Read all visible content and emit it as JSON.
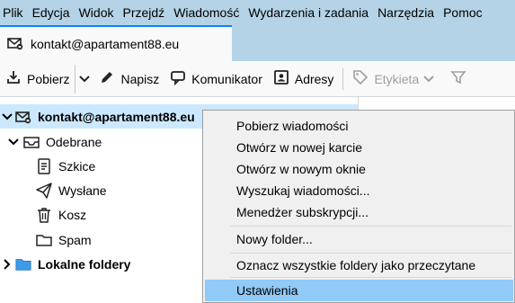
{
  "menubar": {
    "items": [
      "Plik",
      "Edycja",
      "Widok",
      "Przejdź",
      "Wiadomość",
      "Wydarzenia i zadania",
      "Narzędzia",
      "Pomoc"
    ]
  },
  "tab": {
    "label": "kontakt@apartament88.eu"
  },
  "toolbar": {
    "get_label": "Pobierz",
    "write_label": "Napisz",
    "chat_label": "Komunikator",
    "address_label": "Adresy",
    "tag_label": "Etykieta",
    "icons": {
      "get": "download-icon",
      "write": "pencil-icon",
      "chat": "chat-bubble-icon",
      "address": "address-book-icon",
      "tag": "tag-icon",
      "filter": "filter-icon"
    }
  },
  "folders": {
    "account": "kontakt@apartament88.eu",
    "inbox": "Odebrane",
    "drafts": "Szkice",
    "sent": "Wysłane",
    "trash": "Kosz",
    "spam": "Spam",
    "local": "Lokalne foldery"
  },
  "context_menu": {
    "get_messages": "Pobierz wiadomości",
    "open_new_tab": "Otwórz w nowej karcie",
    "open_new_window": "Otwórz w nowym oknie",
    "search_messages": "Wyszukaj wiadomości...",
    "subscription_manager": "Menedżer subskrypcji...",
    "new_folder": "Nowy folder...",
    "mark_all_read": "Oznacz wszystkie foldery jako przeczytane",
    "settings": "Ustawienia"
  },
  "colors": {
    "menubar_bg": "#b4d3e6",
    "selection": "#cce8ff",
    "menu_hover": "#91c9f7",
    "folder_blue": "#3d9ae8"
  }
}
